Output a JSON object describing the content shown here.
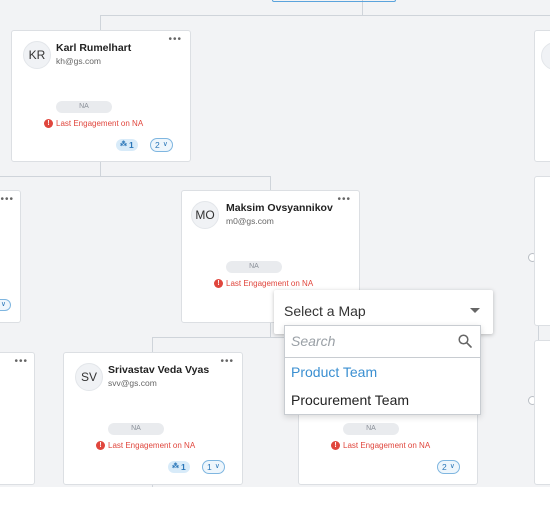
{
  "cards": [
    {
      "initials": "KR",
      "name": "Karl Rumelhart",
      "email": "kh@gs.com",
      "engagement_status": "NA",
      "engagement_text": "Last Engagement on NA",
      "people_count": "1",
      "children_count": "2"
    },
    {
      "initials": "MO",
      "name": "Maksim Ovsyannikov",
      "email": "m0@gs.com",
      "engagement_status": "NA",
      "engagement_text": "Last Engagement on NA"
    },
    {
      "initials": "SV",
      "name": "Srivastav Veda Vyas",
      "email": "svv@gs.com",
      "engagement_status": "NA",
      "engagement_text": "Last Engagement on NA",
      "people_count": "1",
      "children_count": "1"
    },
    {
      "engagement_status": "NA",
      "engagement_text": "Last Engagement on NA",
      "children_count": "2"
    }
  ],
  "map_selector": {
    "label": "Select a Map",
    "search_placeholder": "Search",
    "options": [
      {
        "label": "Product Team",
        "color": "#3a8fd1"
      },
      {
        "label": "Procurement Team",
        "color": "#222222"
      }
    ]
  },
  "icons": {
    "more": "more-icon",
    "warning": "warning-icon",
    "people": "people-icon",
    "chevron": "chevron-down-icon",
    "search": "search-icon"
  }
}
